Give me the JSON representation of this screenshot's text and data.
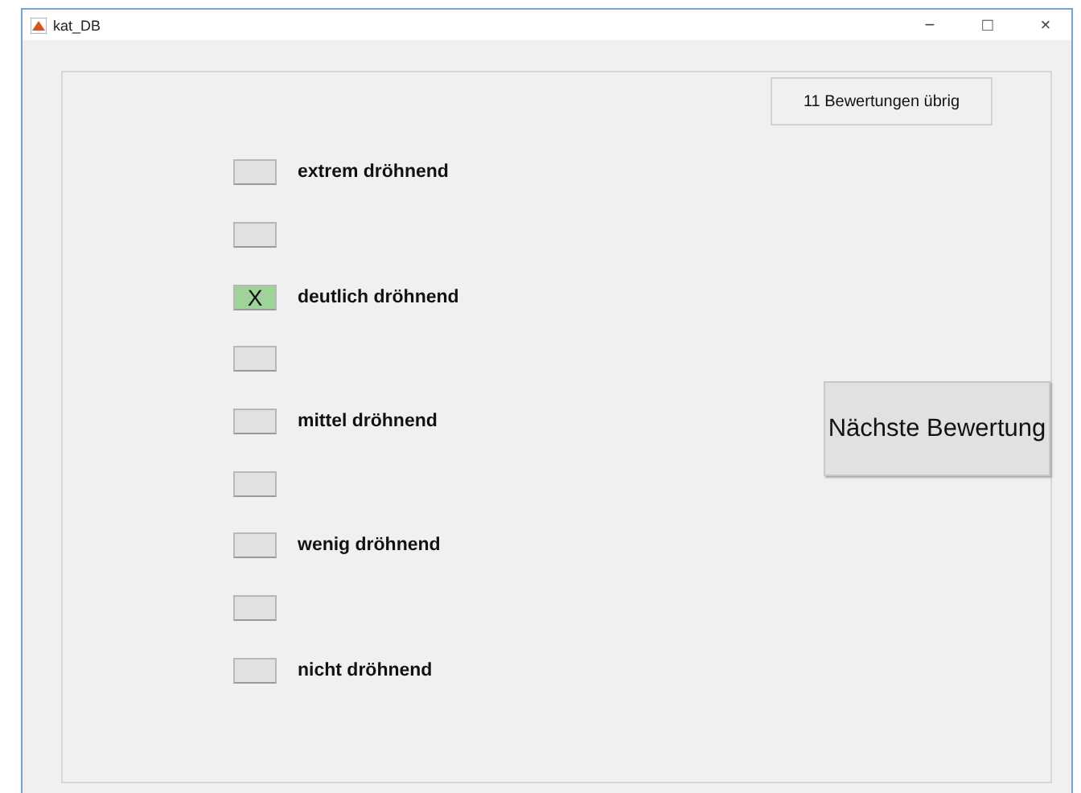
{
  "window": {
    "title": "kat_DB",
    "controls": [
      "−",
      "□",
      "×"
    ]
  },
  "counter": "11 Bewertungen übrig",
  "selected_symbol": "X",
  "scale": [
    {
      "label": "extrem dröhnend",
      "selected": false
    },
    {
      "selected": false
    },
    {
      "label": "deutlich dröhnend",
      "selected": true
    },
    {
      "selected": false
    },
    {
      "label": "mittel dröhnend",
      "selected": false
    },
    {
      "selected": false
    },
    {
      "label": "wenig dröhnend",
      "selected": false
    },
    {
      "selected": false
    },
    {
      "label": "nicht dröhnend",
      "selected": false
    }
  ],
  "next_button": "Nächste Bewertung"
}
